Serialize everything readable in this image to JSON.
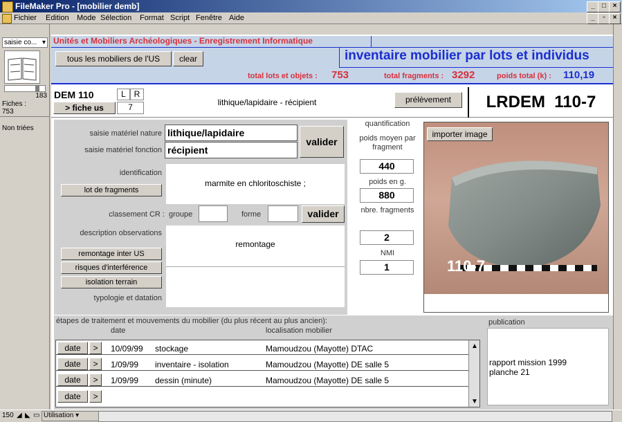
{
  "window": {
    "title": "FileMaker Pro - [mobilier demb]"
  },
  "menu": [
    "Fichier",
    "Edition",
    "Mode",
    "Sélection",
    "Format",
    "Script",
    "Fenêtre",
    "Aide"
  ],
  "sidebar": {
    "layout_select": "saisie co...",
    "record_number": "183",
    "records_label": "Fiches :",
    "records_count": "753",
    "sort_status": "Non triées"
  },
  "header": {
    "app_title": "Unités et Mobiliers Archéologiques - Enregistrement Informatique",
    "btn_all": "tous les mobiliers de l'US",
    "btn_clear": "clear",
    "subtitle": "inventaire mobilier par lots et individus",
    "total_lots_label": "total lots et objets :",
    "total_lots": "753",
    "total_frag_label": "total fragments :",
    "total_frag": "3292",
    "poids_label": "poids total (k) :",
    "poids": "110,19"
  },
  "record": {
    "code": "DEM 110",
    "l": "L",
    "r": "R",
    "fiche_us": "> fiche us",
    "number": "7",
    "category": "lithique/lapidaire - récipient",
    "prelevement": "prélèvement",
    "ref": "LRDEM  110-7"
  },
  "form": {
    "nature_label": "saisie matériel nature",
    "nature_value": "lithique/lapidaire",
    "fonction_label": "saisie matériel fonction",
    "fonction_value": "récipient",
    "valider": "valider",
    "identification_label": "identification",
    "identification_value": "marmite en chloritoschiste ;",
    "lot_btn": "lot de fragments",
    "classement_label": "classement CR :",
    "groupe_label": "groupe",
    "forme_label": "forme",
    "valider2": "valider",
    "description_label": "description observations",
    "description_value": "remontage",
    "remontage_btn": "remontage inter US",
    "risques_btn": "risques d'interférence",
    "isolation_btn": "isolation terrain",
    "typologie_label": "typologie et datation"
  },
  "quant": {
    "title": "quantification",
    "poids_moyen_label": "poids moyen par fragment",
    "poids_moyen": "440",
    "poids_label": "poids en g.",
    "poids": "880",
    "nbre_label": "nbre. fragments",
    "nbre": "2",
    "nmi_label": "NMI",
    "nmi": "1"
  },
  "image": {
    "button": "importer image",
    "caption": "110-7"
  },
  "moves": {
    "title": "étapes de traitement et mouvements du mobilier (du plus récent au plus ancien):",
    "col_date": "date",
    "col_loc": "localisation mobilier",
    "rows": [
      {
        "btn": "date",
        "arrow": ">",
        "date": "10/09/99",
        "action": "stockage",
        "loc": "Mamoudzou (Mayotte) DTAC"
      },
      {
        "btn": "date",
        "arrow": ">",
        "date": "1/09/99",
        "action": "inventaire - isolation",
        "loc": "Mamoudzou (Mayotte) DE salle 5"
      },
      {
        "btn": "date",
        "arrow": ">",
        "date": "1/09/99",
        "action": "dessin (minute)",
        "loc": "Mamoudzou (Mayotte) DE salle 5"
      },
      {
        "btn": "date",
        "arrow": ">",
        "date": "",
        "action": "",
        "loc": ""
      }
    ]
  },
  "publication": {
    "label": "publication",
    "value": "rapport mission 1999\nplanche 21"
  },
  "status": {
    "zoom": "150",
    "mode": "Utilisation"
  }
}
